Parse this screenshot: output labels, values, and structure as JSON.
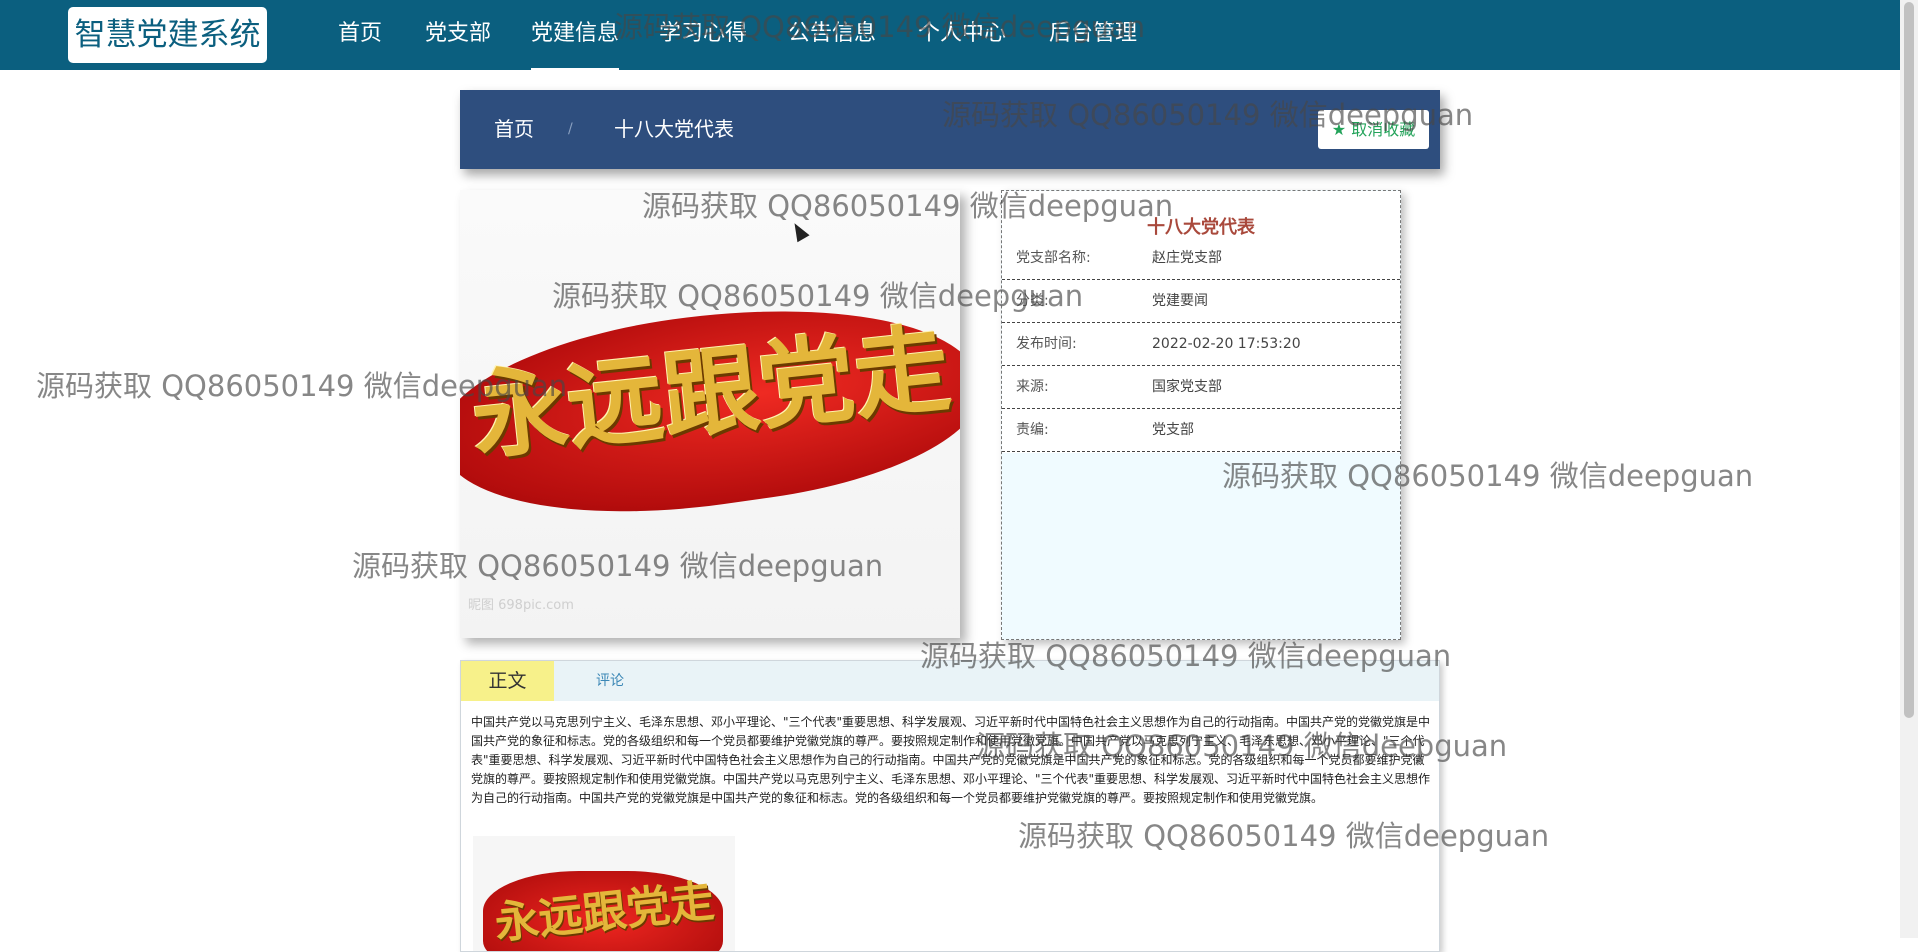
{
  "site": {
    "logo": "智慧党建系统"
  },
  "nav": {
    "home": "首页",
    "branch": "党支部",
    "news": "党建信息",
    "study": "学习心得",
    "notice": "公告信息",
    "personal": "个人中心",
    "admin": "后台管理",
    "active": "党建信息"
  },
  "breadcrumb": {
    "home": "首页",
    "sep": "/",
    "current": "十八大党代表"
  },
  "favorite": {
    "label": "★ 取消收藏"
  },
  "cover": {
    "slogan": "永远跟党走",
    "watermark": "昵图 698pic.com"
  },
  "info": {
    "title": "十八大党代表",
    "rows": [
      {
        "key": "党支部名称:",
        "value": "赵庄党支部"
      },
      {
        "key": "分类:",
        "value": "党建要闻"
      },
      {
        "key": "发布时间:",
        "value": "2022-02-20 17:53:20"
      },
      {
        "key": "来源:",
        "value": "国家党支部"
      },
      {
        "key": "责编:",
        "value": "党支部"
      }
    ]
  },
  "tabs": {
    "body": "正文",
    "comments": "评论"
  },
  "article": {
    "text": "中国共产党以马克思列宁主义、毛泽东思想、邓小平理论、\"三个代表\"重要思想、科学发展观、习近平新时代中国特色社会主义思想作为自己的行动指南。中国共产党的党徽党旗是中国共产党的象征和标志。党的各级组织和每一个党员都要维护党徽党旗的尊严。要按照规定制作和使用党徽党旗。中国共产党以马克思列宁主义、毛泽东思想、邓小平理论、\"三个代表\"重要思想、科学发展观、习近平新时代中国特色社会主义思想作为自己的行动指南。中国共产党的党徽党旗是中国共产党的象征和标志。党的各级组织和每一个党员都要维护党徽党旗的尊严。要按照规定制作和使用党徽党旗。中国共产党以马克思列宁主义、毛泽东思想、邓小平理论、\"三个代表\"重要思想、科学发展观、习近平新时代中国特色社会主义思想作为自己的行动指南。中国共产党的党徽党旗是中国共产党的象征和标志。党的各级组织和每一个党员都要维护党徽党旗的尊严。要按照规定制作和使用党徽党旗。",
    "thumb_text": "永远跟党走"
  },
  "watermark": {
    "text": "源码获取 QQ86050149 微信deepguan"
  }
}
